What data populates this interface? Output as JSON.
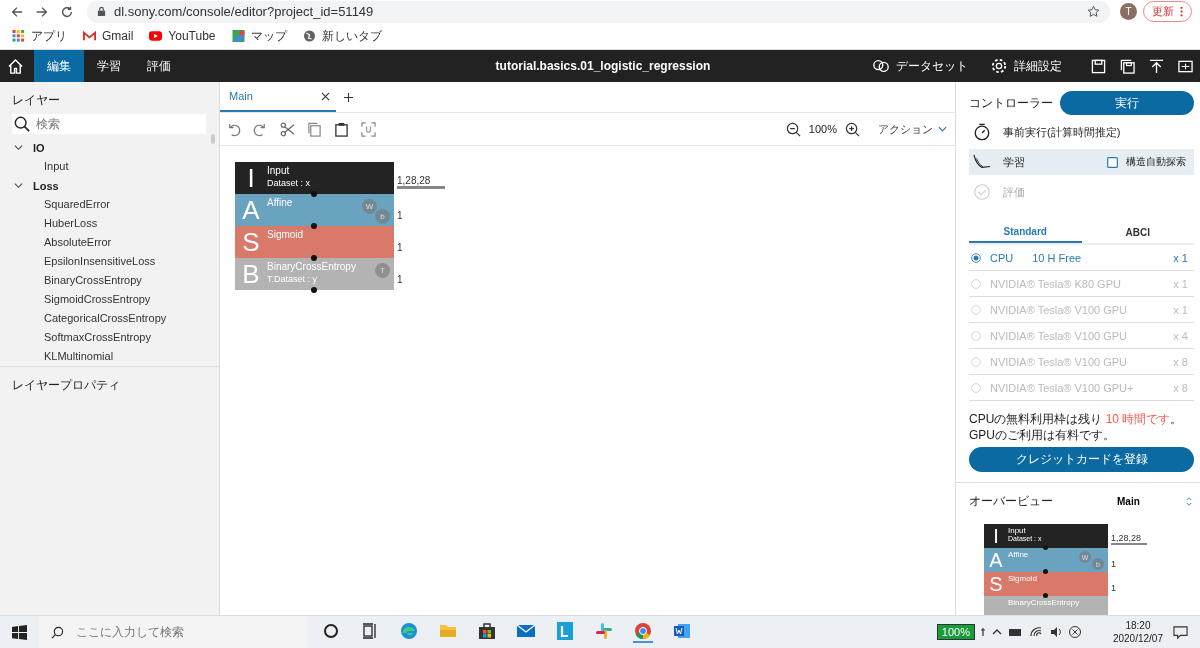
{
  "browser": {
    "url": "dl.sony.com/console/editor?project_id=51149",
    "avatar": "T",
    "update_button": "更新",
    "bookmarks": [
      {
        "label": "アプリ",
        "kind": "apps"
      },
      {
        "label": "Gmail",
        "kind": "gmail"
      },
      {
        "label": "YouTube",
        "kind": "youtube"
      },
      {
        "label": "マップ",
        "kind": "maps"
      },
      {
        "label": "新しいタブ",
        "kind": "globe"
      }
    ]
  },
  "app_bar": {
    "tabs": [
      {
        "label": "編集",
        "selected": true
      },
      {
        "label": "学習",
        "selected": false
      },
      {
        "label": "評価",
        "selected": false
      }
    ],
    "title": "tutorial.basics.01_logistic_regression",
    "actions": [
      {
        "label": "データセット",
        "kind": "dataset"
      },
      {
        "label": "詳細設定",
        "kind": "settings"
      }
    ]
  },
  "layers": {
    "title": "レイヤー",
    "search": {
      "placeholder": "検索"
    },
    "groups": [
      {
        "label": "IO",
        "expanded": true,
        "children": [
          {
            "label": "Input"
          }
        ]
      },
      {
        "label": "Loss",
        "expanded": true,
        "children": [
          {
            "label": "SquaredError"
          },
          {
            "label": "HuberLoss"
          },
          {
            "label": "AbsoluteError"
          },
          {
            "label": "EpsilonInsensitiveLoss"
          },
          {
            "label": "BinaryCrossEntropy"
          },
          {
            "label": "SigmoidCrossEntropy"
          },
          {
            "label": "CategoricalCrossEntropy"
          },
          {
            "label": "SoftmaxCrossEntropy"
          },
          {
            "label": "KLMultinomial"
          }
        ]
      }
    ],
    "properties_title": "レイヤープロパティ"
  },
  "editor": {
    "tabs": [
      {
        "label": "Main",
        "selected": true
      }
    ],
    "zoom": "100%",
    "action_menu": "アクション",
    "nodes": [
      {
        "letter": "I",
        "name": "Input",
        "sub": "Dataset : x",
        "color": "#232323",
        "output": "1,28,28",
        "output_bar": true
      },
      {
        "letter": "A",
        "name": "Affine",
        "color": "#6aa3c0",
        "badges": [
          "W",
          "b"
        ],
        "output": "1",
        "output_bar": false
      },
      {
        "letter": "S",
        "name": "Sigmoid",
        "color": "#d8796a",
        "output": "1",
        "output_bar": false
      },
      {
        "letter": "B",
        "name": "BinaryCrossEntropy",
        "sub": "T.Dataset : y",
        "color": "#b3b3b3",
        "badges": [
          "T"
        ],
        "output": "1",
        "output_bar": false
      }
    ]
  },
  "controller": {
    "title": "コントローラー",
    "run_button": "実行",
    "modes": [
      {
        "label": "事前実行(計算時間推定)",
        "kind": "timer",
        "selected": false,
        "disabled": false
      },
      {
        "label": "学習",
        "kind": "train",
        "selected": true,
        "disabled": false,
        "option": {
          "label": "構造自動探索",
          "checked": false
        }
      },
      {
        "label": "評価",
        "kind": "check",
        "selected": false,
        "disabled": true
      }
    ],
    "tabs": [
      {
        "label": "Standard",
        "selected": true
      },
      {
        "label": "ABCI",
        "selected": false
      }
    ],
    "processors": [
      {
        "name": "CPU",
        "note": "10 H Free",
        "count": "x 1",
        "selected": true,
        "disabled": false
      },
      {
        "name": "NVIDIA® Tesla® K80 GPU",
        "count": "x 1",
        "selected": false,
        "disabled": true
      },
      {
        "name": "NVIDIA® Tesla® V100 GPU",
        "count": "x 1",
        "selected": false,
        "disabled": true
      },
      {
        "name": "NVIDIA® Tesla® V100 GPU",
        "count": "x 4",
        "selected": false,
        "disabled": true
      },
      {
        "name": "NVIDIA® Tesla® V100 GPU",
        "count": "x 8",
        "selected": false,
        "disabled": true
      },
      {
        "name": "NVIDIA® Tesla® V100 GPU+",
        "count": "x 8",
        "selected": false,
        "disabled": true
      }
    ],
    "notice": [
      {
        "text": "CPUの無料利用枠は残り ",
        "kind": "plain"
      },
      {
        "text": "10 時間です",
        "kind": "highlight"
      },
      {
        "text": "。 GPUのご利用は有料です。",
        "kind": "plain"
      }
    ],
    "credit_button": "クレジットカードを登録"
  },
  "overview": {
    "title": "オーバービュー",
    "graph": "Main",
    "nodes": [
      {
        "letter": "I",
        "name": "Input",
        "sub": "Dataset : x",
        "color": "#232323",
        "output": "1,28,28",
        "output_bar": true
      },
      {
        "letter": "A",
        "name": "Affine",
        "color": "#6aa3c0",
        "badges": [
          "W",
          "b"
        ],
        "output": "1",
        "output_bar": false
      },
      {
        "letter": "S",
        "name": "Sigmoid",
        "color": "#d8796a",
        "output": "1",
        "output_bar": false
      },
      {
        "name": "BinaryCrossEntropy",
        "color": "#b3b3b3"
      }
    ]
  },
  "taskbar": {
    "search": {
      "placeholder": "ここに入力して検索"
    },
    "apps": [
      {
        "kind": "cortana"
      },
      {
        "kind": "taskview"
      },
      {
        "kind": "edge"
      },
      {
        "kind": "explorer"
      },
      {
        "kind": "store"
      },
      {
        "kind": "mail"
      },
      {
        "kind": "lapp"
      },
      {
        "kind": "slack"
      },
      {
        "kind": "chrome"
      },
      {
        "kind": "word"
      }
    ],
    "battery": "100%",
    "time": "18:20",
    "date": "2020/12/07"
  }
}
